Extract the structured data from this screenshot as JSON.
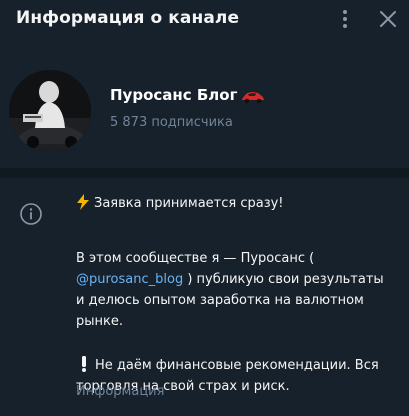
{
  "header": {
    "title": "Информация о канале",
    "menu_icon": "more-vertical-icon",
    "close_icon": "close-icon"
  },
  "channel": {
    "name": "Пуросанс Блог",
    "name_emoji": "red-sports-car-icon",
    "subscribers": "5 873 подписчика",
    "avatar_icon": "channel-avatar"
  },
  "info": {
    "icon": "info-icon",
    "line1": "Заявка принимается сразу!",
    "paragraph2_before": "В этом сообществе я — Пуросанс (",
    "paragraph2_link": "@purosanc_blog",
    "paragraph2_after": ") публикую свои результаты и делюсь опытом заработка на валютном рынке.",
    "paragraph3": "Не даём финансовые рекомендации. Вся торговля на свой страх и риск.",
    "caption": "Информация"
  },
  "colors": {
    "background": "#17212b",
    "text": "#f5f5f5",
    "secondary": "#708499",
    "link": "#6ab3f3",
    "divider": "#101820"
  }
}
